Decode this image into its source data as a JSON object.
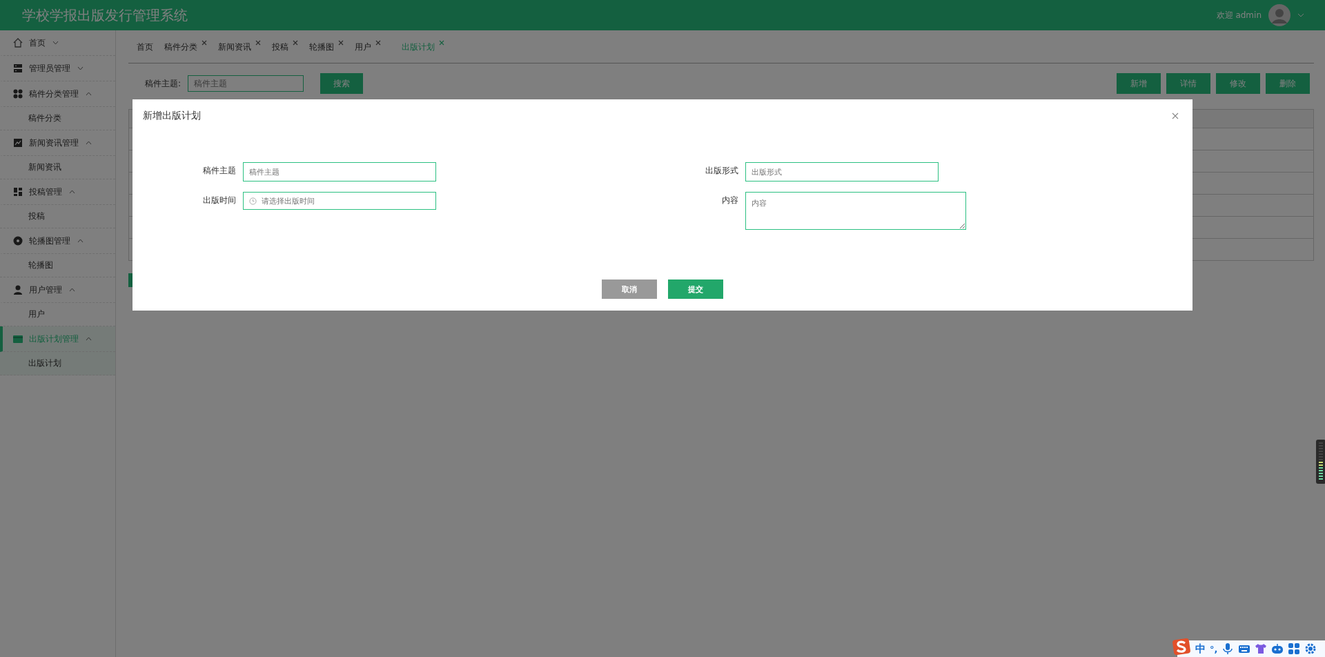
{
  "header": {
    "title": "学校学报出版发行管理系统",
    "welcome": "欢迎 admin"
  },
  "sidebar": {
    "items": [
      {
        "label": "首页",
        "expanded": false,
        "selected": false
      },
      {
        "label": "管理员管理",
        "expanded": false,
        "selected": false
      },
      {
        "label": "稿件分类管理",
        "expanded": true,
        "selected": false,
        "children": [
          {
            "label": "稿件分类",
            "selected": false
          }
        ]
      },
      {
        "label": "新闻资讯管理",
        "expanded": true,
        "selected": false,
        "children": [
          {
            "label": "新闻资讯",
            "selected": false
          }
        ]
      },
      {
        "label": "投稿管理",
        "expanded": true,
        "selected": false,
        "children": [
          {
            "label": "投稿",
            "selected": false
          }
        ]
      },
      {
        "label": "轮播图管理",
        "expanded": true,
        "selected": false,
        "children": [
          {
            "label": "轮播图",
            "selected": false
          }
        ]
      },
      {
        "label": "用户管理",
        "expanded": true,
        "selected": false,
        "children": [
          {
            "label": "用户",
            "selected": false
          }
        ]
      },
      {
        "label": "出版计划管理",
        "expanded": true,
        "selected": true,
        "children": [
          {
            "label": "出版计划",
            "selected": true
          }
        ]
      }
    ]
  },
  "tabs": [
    {
      "label": "首页",
      "closable": false,
      "selected": false
    },
    {
      "label": "稿件分类",
      "closable": true,
      "selected": false
    },
    {
      "label": "新闻资讯",
      "closable": true,
      "selected": false
    },
    {
      "label": "投稿",
      "closable": true,
      "selected": false
    },
    {
      "label": "轮播图",
      "closable": true,
      "selected": false
    },
    {
      "label": "用户",
      "closable": true,
      "selected": false
    },
    {
      "label": "出版计划",
      "closable": true,
      "selected": true
    }
  ],
  "search": {
    "label": "稿件主题:",
    "placeholder": "稿件主题",
    "button": "搜索"
  },
  "actions": [
    "新增",
    "详情",
    "修改",
    "删除"
  ],
  "dialog": {
    "title": "新增出版计划",
    "fields": [
      {
        "label": "稿件主题",
        "placeholder": "稿件主题",
        "kind": "text"
      },
      {
        "label": "出版形式",
        "placeholder": "出版形式",
        "kind": "text"
      },
      {
        "label": "出版时间",
        "placeholder": "请选择出版时间",
        "kind": "date"
      },
      {
        "label": "内容",
        "placeholder": "内容",
        "kind": "textarea"
      }
    ],
    "buttons": [
      {
        "label": "取消",
        "kind": "cancel"
      },
      {
        "label": "提交",
        "kind": "submit"
      }
    ]
  },
  "ime_toolbar": {
    "mode": "中",
    "punctuation": "°,"
  }
}
